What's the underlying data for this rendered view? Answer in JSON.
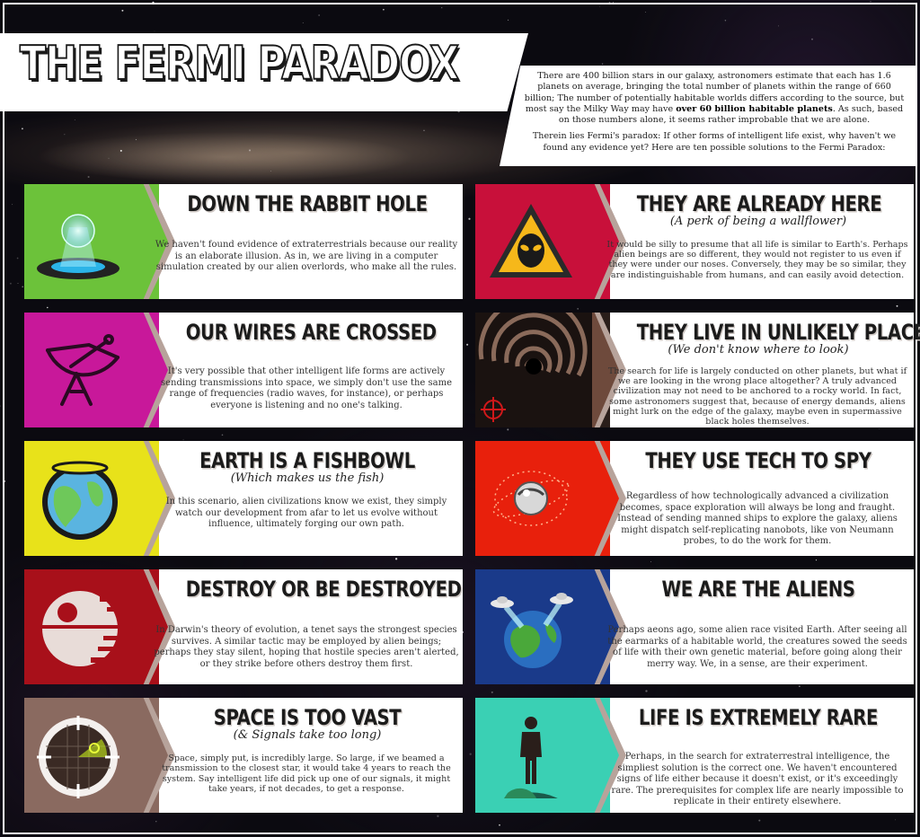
{
  "title": "THE FERMI PARADOX",
  "intro": {
    "p1_a": "There are 400 billion stars in our galaxy, astronomers estimate that each has 1.6 planets on average, bringing the total number of planets within the range of 660 billion; The number of potentially habitable worlds differs according to the source, but most say the Milky Way may have ",
    "p1_bold": "over 60 billion habitable planets",
    "p1_b": ". As such, based on those numbers alone, it seems rather improbable that we are alone.",
    "p2": "Therein lies Fermi's paradox: If other forms of intelligent life exist, why haven't we found any evidence yet? Here are ten possible solutions to the Fermi Paradox:"
  },
  "cards": [
    {
      "heading": "DOWN THE RABBIT HOLE",
      "subheading": "",
      "body": "We haven't found evidence of extraterrestrials because our reality is an elaborate illusion. As in, we are living in a computer simulation created by our alien overlords, who make all the rules.",
      "icon": "hologram-globe-icon",
      "color": "#6cc23a"
    },
    {
      "heading": "THEY ARE ALREADY HERE",
      "subheading": "(A perk of being a wallflower)",
      "body": "It would be silly to presume that all life is similar to Earth's. Perhaps alien beings are so different, they would not register to us even if they were under our noses. Conversely, they may be so similar, they are indistinguishable from humans, and can easily avoid detection.",
      "icon": "alien-warning-sign-icon",
      "color": "#c8103a"
    },
    {
      "heading": "OUR WIRES ARE CROSSED",
      "subheading": "",
      "body": "It's very possible that other intelligent life forms are actively sending transmissions into space, we simply don't use the same range of frequencies (radio waves, for instance), or perhaps everyone is listening and no one's talking.",
      "icon": "satellite-dish-icon",
      "color": "#c8189a"
    },
    {
      "heading": "THEY LIVE IN UNLIKELY PLACES",
      "subheading": "(We don't know where to look)",
      "body": "The search for life is largely conducted on other planets, but what if we are looking in the wrong place altogether? A truly advanced civilization may not need to be anchored to a rocky world. In fact, some astronomers suggest that, because of energy demands, aliens might lurk on the edge of the galaxy, maybe even in supermassive black holes themselves.",
      "icon": "black-hole-icon",
      "color": "#6e4a3c"
    },
    {
      "heading": "EARTH IS A FISHBOWL",
      "subheading": "(Which makes us the fish)",
      "body": "In this scenario, alien civilizations know we exist, they simply watch our development from afar to let us evolve without influence, ultimately forging our own path.",
      "icon": "earth-fishbowl-icon",
      "color": "#e8e21a"
    },
    {
      "heading": "THEY USE TECH TO SPY",
      "subheading": "",
      "body": "Regardless of how technologically advanced a civilization becomes, space exploration will always be long and fraught. Instead of sending manned ships to explore the galaxy, aliens might dispatch self-replicating nanobots, like von Neumann probes, to do the work for them.",
      "icon": "nanobot-probe-icon",
      "color": "#e8200c"
    },
    {
      "heading": "DESTROY OR BE DESTROYED",
      "subheading": "",
      "body": "In Darwin's theory of evolution, a tenet says the strongest species survives. A similar tactic may be employed by alien beings; perhaps they stay silent, hoping that hostile species aren't alerted, or they strike before others destroy them first.",
      "icon": "death-star-icon",
      "color": "#a8101a"
    },
    {
      "heading": "WE ARE THE ALIENS",
      "subheading": "",
      "body": "Perhaps aeons ago, some alien race visited Earth. After seeing all the earmarks of a habitable world, the creatures sowed the seeds of life with their own genetic material, before going along their merry way. We, in a sense, are their experiment.",
      "icon": "earth-ufos-icon",
      "color": "#1a3a8a"
    },
    {
      "heading": "SPACE IS TOO VAST",
      "subheading": "(& Signals take too long)",
      "body": "Space, simply put, is incredibly large. So large, if we beamed a transmission to the closest star, it would take 4 years to reach the system. Say intelligent life did pick up one of our signals, it might take years, if not decades, to get a response.",
      "icon": "radar-scope-icon",
      "color": "#8a6a60"
    },
    {
      "heading": "LIFE IS EXTREMELY RARE",
      "subheading": "",
      "body": "Perhaps, in the search for extraterrestral intelligence, the simpliest solution is the correct one. We haven't encountered signs of life either because it doesn't exist, or it's exceedingly rare. The prerequisites for complex life are nearly impossible to replicate in their entirety elsewhere.",
      "icon": "person-on-earth-icon",
      "color": "#3ad0b4"
    }
  ]
}
